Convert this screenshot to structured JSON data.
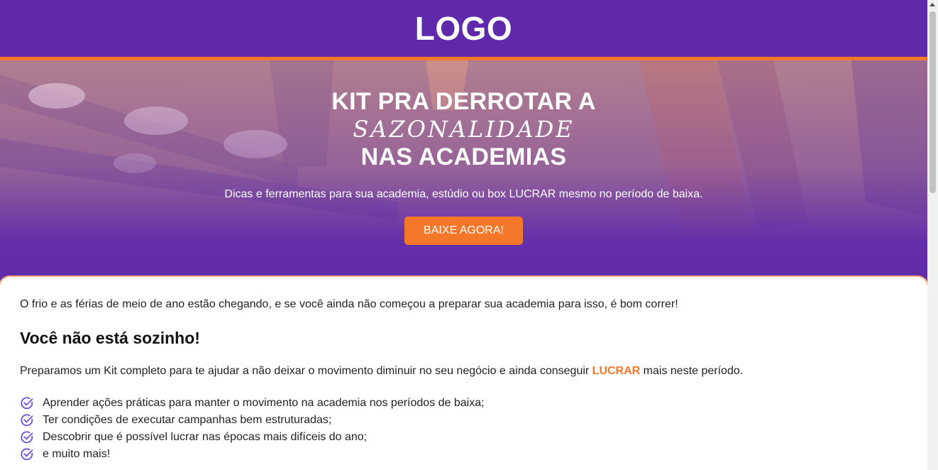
{
  "header": {
    "logo": "LOGO"
  },
  "hero": {
    "line1": "KIT PRA DERROTAR A",
    "line2": "SAZONALIDADE",
    "line3": "NAS ACADEMIAS",
    "subtitle": "Dicas e ferramentas para sua academia, estúdio ou box LUCRAR mesmo no período de baixa.",
    "cta_label": "BAIXE AGORA!"
  },
  "content": {
    "intro": "O frio e as férias de meio de ano estão chegando, e se você ainda não começou a preparar sua academia para isso, é bom correr!",
    "title": "Você não está sozinho!",
    "desc_before": "Preparamos um Kit completo para te ajudar a não deixar o movimento diminuir no seu negócio e ainda conseguir ",
    "desc_highlight": "LUCRAR",
    "desc_after": " mais neste período.",
    "list": [
      "Aprender ações práticas para manter o movimento na academia nos períodos de baixa;",
      "Ter condições de executar campanhas bem estruturadas;",
      "Descobrir que é possível lucrar nas épocas mais difíceis do ano;",
      "e muito mais!"
    ]
  },
  "colors": {
    "purple": "#5e2aab",
    "orange": "#f4772a",
    "check": "#6c52d9"
  },
  "icons": {
    "list_marker": "check-circle-icon"
  }
}
